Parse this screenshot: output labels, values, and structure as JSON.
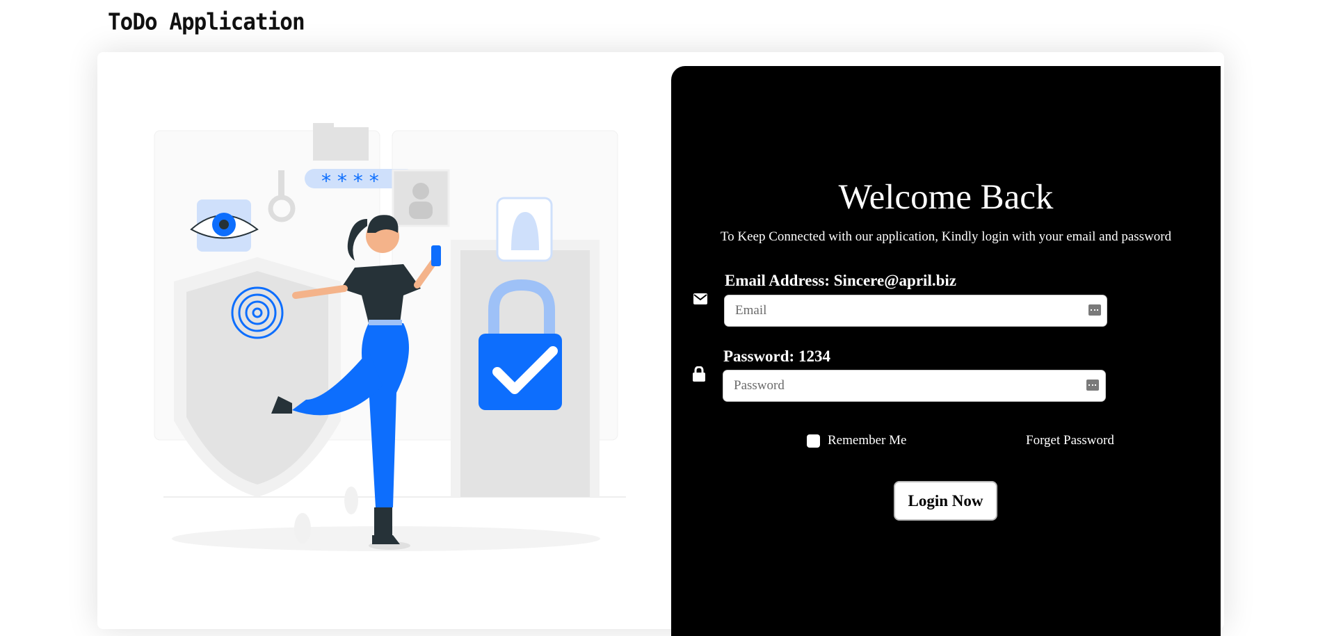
{
  "app": {
    "brand": "ToDo Application"
  },
  "login": {
    "title": "Welcome Back",
    "subtitle": "To Keep Connected with our application, Kindly login with your email and password",
    "email": {
      "label": "Email Address: Sincere@april.biz",
      "placeholder": "Email",
      "value": ""
    },
    "password": {
      "label": "Password: 1234",
      "placeholder": "Password",
      "value": ""
    },
    "remember_label": "Remember Me",
    "forget_label": "Forget Password",
    "login_button": "Login Now"
  },
  "illustration": {
    "password_mask": "* * * *"
  },
  "colors": {
    "panel": "#000000",
    "accent": "#0d6efd",
    "page": "#ffffff"
  }
}
